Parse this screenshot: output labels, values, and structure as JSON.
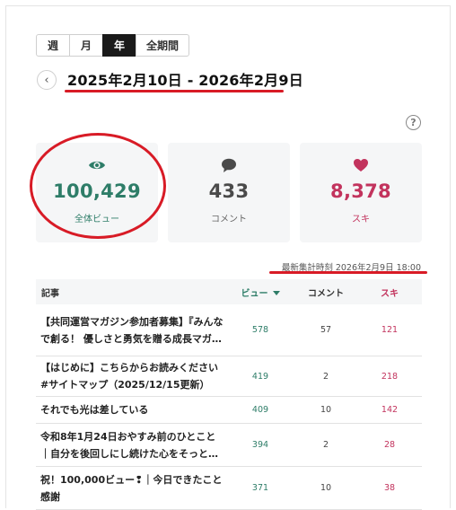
{
  "period_tabs": [
    {
      "label": "週",
      "active": false
    },
    {
      "label": "月",
      "active": false
    },
    {
      "label": "年",
      "active": true
    },
    {
      "label": "全期間",
      "active": false
    }
  ],
  "date_range": "2025年2月10日 - 2026年2月9日",
  "stats": {
    "views": {
      "value": "100,429",
      "label": "全体ビュー",
      "icon": "eye-icon"
    },
    "comments": {
      "value": "433",
      "label": "コメント",
      "icon": "comment-icon"
    },
    "likes": {
      "value": "8,378",
      "label": "スキ",
      "icon": "heart-icon"
    }
  },
  "last_updated": "最新集計時刻 2026年2月9日 18:00",
  "table": {
    "headers": {
      "title": "記事",
      "views": "ビュー",
      "comments": "コメント",
      "likes": "スキ"
    },
    "rows": [
      {
        "title_line1": "【共同運営マガジン参加者募集】『みんな",
        "title_line2": "で創る！ 優しさと勇気を贈る成長マガ…",
        "views": "578",
        "comments": "57",
        "likes": "121"
      },
      {
        "title_line1": "【はじめに】こちらからお読みください",
        "title_line2": "#サイトマップ（2025/12/15更新）",
        "views": "419",
        "comments": "2",
        "likes": "218"
      },
      {
        "title_line1": "それでも光は差している",
        "title_line2": "",
        "views": "409",
        "comments": "10",
        "likes": "142"
      },
      {
        "title_line1": "令和8年1月24日おやすみ前のひとこと",
        "title_line2": "｜自分を後回しにし続けた心をそっと…",
        "views": "394",
        "comments": "2",
        "likes": "28"
      },
      {
        "title_line1": "祝！100,000ビュー❢｜今日できたこと｜",
        "title_line2": "感謝",
        "views": "371",
        "comments": "10",
        "likes": "38"
      }
    ]
  },
  "colors": {
    "accent_green": "#2e7d68",
    "accent_pink": "#c2335d",
    "annotation_red": "#d81b26"
  }
}
